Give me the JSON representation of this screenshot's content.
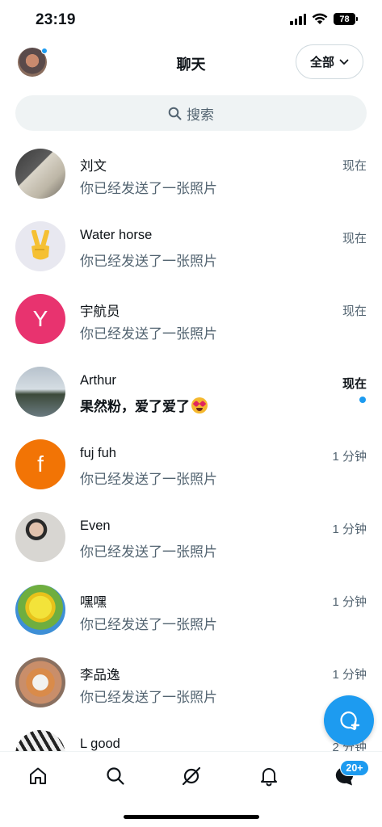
{
  "status_bar": {
    "time": "23:19",
    "battery": "78"
  },
  "header": {
    "title": "聊天",
    "filter_label": "全部"
  },
  "search": {
    "label": "搜索"
  },
  "chats": [
    {
      "name": "刘文",
      "preview": "你已经发送了一张照片",
      "time": "现在",
      "unread": false
    },
    {
      "name": "Water horse",
      "preview": "你已经发送了一张照片",
      "time": "现在",
      "unread": false
    },
    {
      "name": "宇航员",
      "preview": "你已经发送了一张照片",
      "time": "现在",
      "unread": false,
      "avatar_letter": "Y",
      "avatar_color": "#e8336f"
    },
    {
      "name": "Arthur",
      "preview": "果然粉，爱了爱了",
      "time": "现在",
      "unread": true
    },
    {
      "name": "fuj fuh",
      "preview": "你已经发送了一张照片",
      "time": "1 分钟",
      "unread": false,
      "avatar_letter": "f",
      "avatar_color": "#f27405"
    },
    {
      "name": "Even",
      "preview": "你已经发送了一张照片",
      "time": "1 分钟",
      "unread": false
    },
    {
      "name": "嘿嘿",
      "preview": "你已经发送了一张照片",
      "time": "1 分钟",
      "unread": false
    },
    {
      "name": "李品逸",
      "preview": "你已经发送了一张照片",
      "time": "1 分钟",
      "unread": false
    },
    {
      "name": "L good",
      "preview": "",
      "time": "2 分钟",
      "unread": false
    }
  ],
  "bottom_nav": {
    "messages_badge": "20+"
  },
  "colors": {
    "accent": "#1d9bf0",
    "secondary_text": "#536471",
    "search_bg": "#eff3f4"
  }
}
